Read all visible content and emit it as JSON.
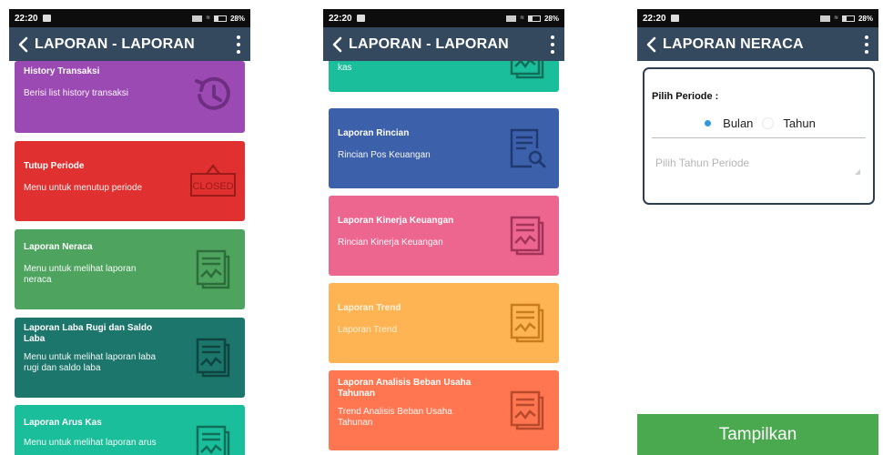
{
  "status": {
    "time": "22:20",
    "battery": "28%"
  },
  "screen1": {
    "title": "LAPORAN - LAPORAN",
    "cards": [
      {
        "title": "History Transaksi",
        "desc": "Berisi list history transaksi",
        "icon": "history-icon"
      },
      {
        "title": "Tutup Periode",
        "desc": "Menu untuk menutup periode",
        "icon": "closed-sign-icon",
        "icon_text": "CLOSED"
      },
      {
        "title": "Laporan Neraca",
        "desc": "Menu untuk melihat laporan neraca",
        "icon": "report-chart-icon"
      },
      {
        "title": "Laporan Laba Rugi dan Saldo Laba",
        "desc": "Menu untuk melihat laporan laba rugi dan saldo laba",
        "icon": "report-chart-icon"
      },
      {
        "title": "Laporan Arus Kas",
        "desc": "Menu untuk melihat laporan arus",
        "icon": "report-chart-icon"
      }
    ]
  },
  "screen2": {
    "title": "LAPORAN - LAPORAN",
    "cards": [
      {
        "title": "",
        "desc": "kas",
        "icon": "report-chart-icon"
      },
      {
        "title": "Laporan Rincian",
        "desc": "Rincian Pos Keuangan",
        "icon": "document-search-icon"
      },
      {
        "title": "Laporan Kinerja Keuangan",
        "desc": "Rincian Kinerja Keuangan",
        "icon": "report-chart-icon"
      },
      {
        "title": "Laporan Trend",
        "desc": "Laporan Trend",
        "icon": "report-chart-icon"
      },
      {
        "title": "Laporan Analisis Beban Usaha Tahunan",
        "desc": "Trend Analisis Beban Usaha Tahunan",
        "icon": "report-chart-icon"
      }
    ]
  },
  "screen3": {
    "title": "LAPORAN NERACA",
    "period_label": "Pilih Periode :",
    "options": [
      "Bulan",
      "Tahun"
    ],
    "selected_option": "Bulan",
    "year_placeholder": "Pilih Tahun Periode",
    "submit_label": "Tampilkan"
  },
  "colors": {
    "appbar": "#34495e",
    "history": "#9b49b3",
    "tutup": "#e03130",
    "neraca": "#4ea45f",
    "laba_rugi": "#1c766c",
    "arus_kas": "#1bbe9a",
    "rincian": "#3d60aa",
    "kinerja": "#ed6690",
    "trend": "#ffb454",
    "analisis": "#ff7651",
    "submit": "#4aa84f",
    "radio_selected": "#3498db"
  }
}
